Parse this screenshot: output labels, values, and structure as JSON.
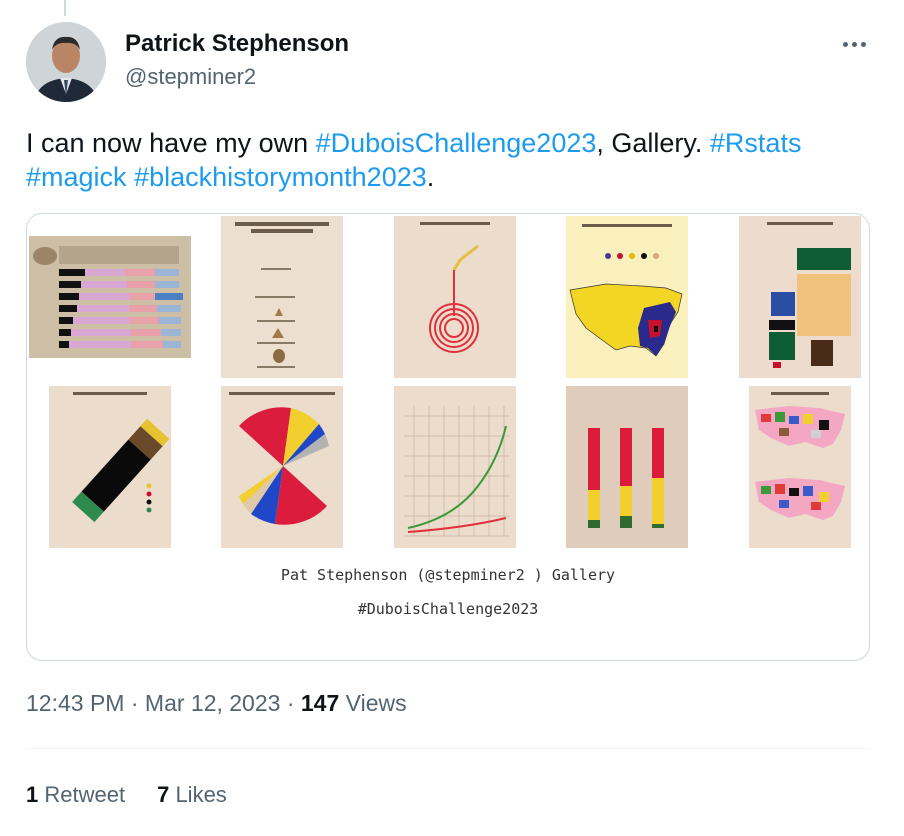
{
  "author": {
    "name": "Patrick Stephenson",
    "handle": "@stepminer2"
  },
  "tweet": {
    "text_before": "I can now have my own ",
    "tag1": "#DuboisChallenge2023",
    "text_mid": ", Gallery. ",
    "tag2": "#Rstats",
    "space1": " ",
    "tag3": "#magick",
    "space2": " ",
    "tag4": "#blackhistorymonth2023",
    "text_end": "."
  },
  "media": {
    "gallery_title": "Pat Stephenson (@stepminer2 ) Gallery",
    "gallery_tag": "#DuboisChallenge2023",
    "thumbnails": [
      {
        "name": "thumb-income-bars",
        "title": "INCOME AND EXPENDITURE OF 150 NEGRO FAMILIES"
      },
      {
        "name": "thumb-gdp-caribbean",
        "title": "ASSESSED GDP PER CAPITA FOR SELECTED CARIBBEAN COUNTRIES."
      },
      {
        "name": "thumb-spiral",
        "title": "CITY AND RURAL POPULATION"
      },
      {
        "name": "thumb-us-map-yellow",
        "title": "DISTRIBUTION OF NEGROES IN THE UNITED STATES"
      },
      {
        "name": "thumb-blocks",
        "title": "NEGRO BUSINESS MEN IN THE UNITED STATES"
      },
      {
        "name": "thumb-diagonal-bar",
        "title": ""
      },
      {
        "name": "thumb-occupations-pie",
        "title": "OCCUPATIONS OF NEGROES AND WHITES IN GEORGIA."
      },
      {
        "name": "thumb-line-chart",
        "title": ""
      },
      {
        "name": "thumb-stacked-bars",
        "title": ""
      },
      {
        "name": "thumb-migration-maps",
        "title": "MIGRATION OF NEGROES. 1913."
      }
    ]
  },
  "meta": {
    "time": "12:43 PM",
    "sep1": " · ",
    "date": "Mar 12, 2023",
    "sep2": " · ",
    "views_count": "147",
    "views_label": " Views"
  },
  "stats": {
    "retweets_count": "1",
    "retweets_label": " Retweet",
    "likes_count": "7",
    "likes_label": " Likes"
  },
  "colors": {
    "accent": "#1d9bf0",
    "text": "#0f1419",
    "muted": "#536471"
  },
  "icons": {
    "more": "more-horizontal-icon"
  }
}
